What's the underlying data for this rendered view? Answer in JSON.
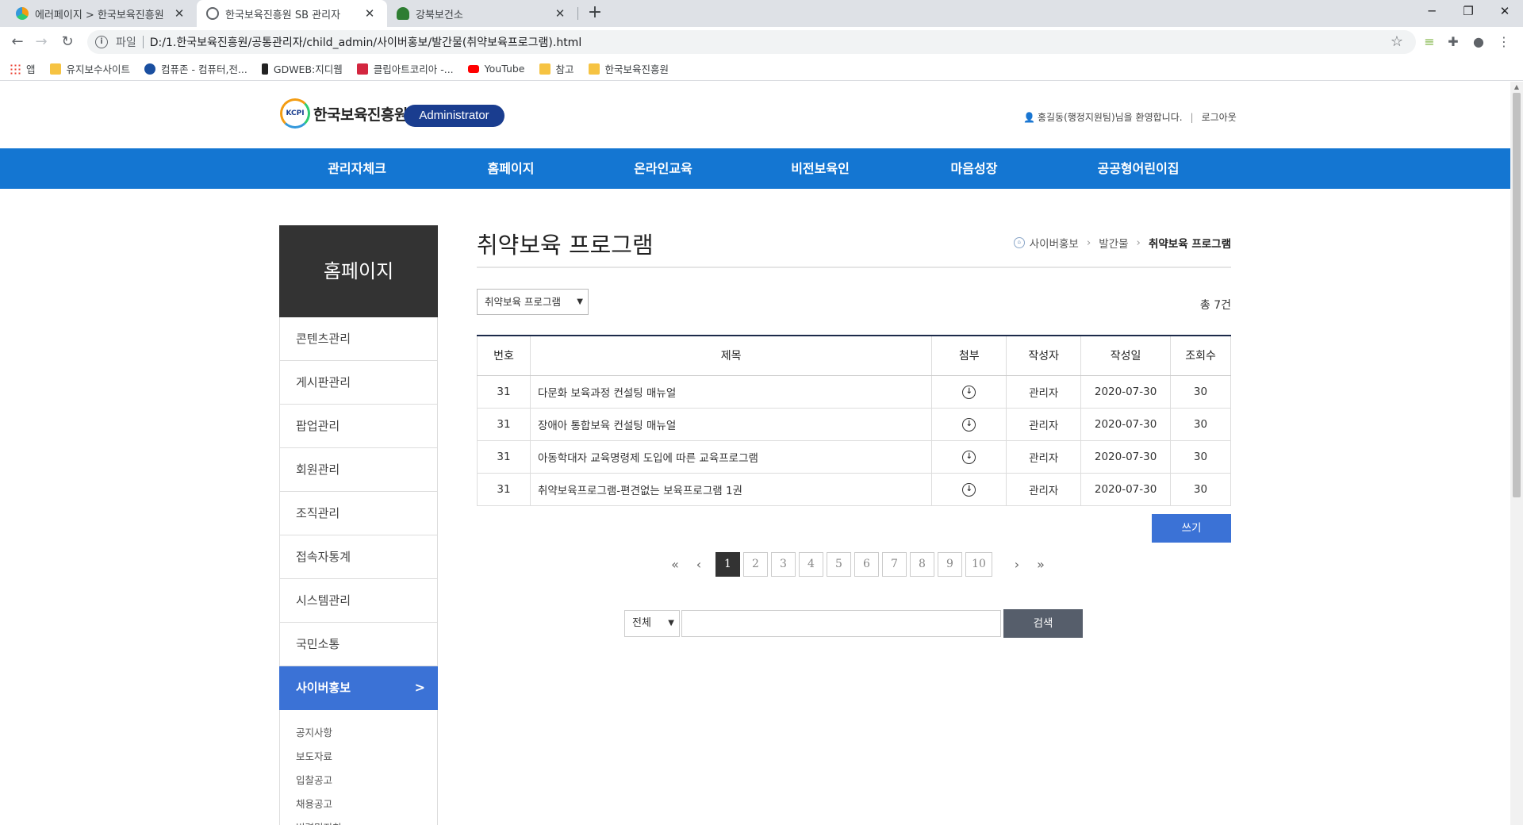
{
  "browser": {
    "tabs": [
      {
        "title": "에러페이지 > 한국보육진흥원",
        "active": false
      },
      {
        "title": "한국보육진흥원 SB 관리자",
        "active": true
      },
      {
        "title": "강북보건소",
        "active": false
      }
    ],
    "new_tab": "+",
    "url_scheme": "파일",
    "url": "D:/1.한국보육진흥원/공통관리자/child_admin/사이버홍보/발간물(취약보육프로그램).html",
    "bookmarks": [
      {
        "label": "앱",
        "color": "#ea4335"
      },
      {
        "label": "유지보수사이트",
        "color": "#f6c342"
      },
      {
        "label": "컴퓨존 - 컴퓨터,전...",
        "color": "#1a4fa0"
      },
      {
        "label": "GDWEB:지디웹",
        "color": "#222222"
      },
      {
        "label": "클립아트코리아 -...",
        "color": "#d3263f"
      },
      {
        "label": "YouTube",
        "color": "#ff0000"
      },
      {
        "label": "참고",
        "color": "#f6c342"
      },
      {
        "label": "한국보육진흥원",
        "color": "#f6c342"
      }
    ]
  },
  "header": {
    "logo_text": "한국보육진흥원",
    "logo_mark": "KCPI",
    "admin_label": "Administrator",
    "welcome": "홍길동(행정지원팀)님을 환영합니다.",
    "separator": "|",
    "logout": "로그아웃"
  },
  "gnb": [
    "관리자체크",
    "홈페이지",
    "온라인교육",
    "비전보육인",
    "마음성장",
    "공공형어린이집"
  ],
  "sidebar": {
    "title": "홈페이지",
    "items": [
      "콘텐츠관리",
      "게시판관리",
      "팝업관리",
      "회원관리",
      "조직관리",
      "접속자통계",
      "시스템관리",
      "국민소통"
    ],
    "active": "사이버홍보",
    "active_chevron": ">",
    "sub_items": [
      "공지사항",
      "보도자료",
      "입찰공고",
      "채용공고",
      "법령및지침"
    ]
  },
  "content": {
    "title": "취약보육 프로그램",
    "breadcrumb": [
      "사이버홍보",
      "발간물",
      "취약보육 프로그램"
    ],
    "category_select": "취약보육 프로그램",
    "total": "총 7건",
    "table": {
      "headers": [
        "번호",
        "제목",
        "첨부",
        "작성자",
        "작성일",
        "조회수"
      ],
      "rows": [
        {
          "no": "31",
          "title": "다문화 보육과정 컨설팅 매뉴얼",
          "author": "관리자",
          "date": "2020-07-30",
          "views": "30"
        },
        {
          "no": "31",
          "title": "장애아 통합보육 컨설팅 매뉴얼",
          "author": "관리자",
          "date": "2020-07-30",
          "views": "30"
        },
        {
          "no": "31",
          "title": "아동학대자 교육명령제 도입에 따른 교육프로그램",
          "author": "관리자",
          "date": "2020-07-30",
          "views": "30"
        },
        {
          "no": "31",
          "title": "취약보육프로그램-편견없는 보육프로그램 1권",
          "author": "관리자",
          "date": "2020-07-30",
          "views": "30"
        }
      ]
    },
    "write_button": "쓰기",
    "pagination": {
      "pages": [
        "1",
        "2",
        "3",
        "4",
        "5",
        "6",
        "7",
        "8",
        "9",
        "10"
      ],
      "current": "1"
    },
    "search": {
      "scope": "전체",
      "button": "검색"
    }
  }
}
